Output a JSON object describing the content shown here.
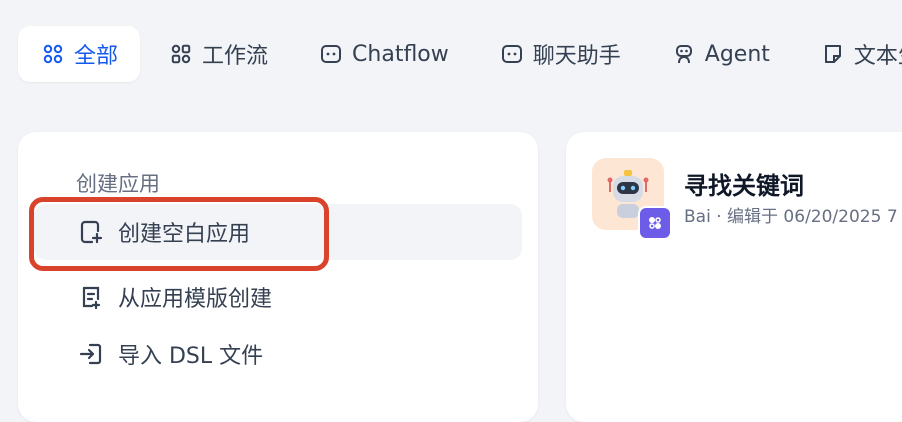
{
  "tabs": [
    {
      "label": "全部",
      "icon": "grid-icon",
      "active": true
    },
    {
      "label": "工作流",
      "icon": "workflow-icon",
      "active": false
    },
    {
      "label": "Chatflow",
      "icon": "chatflow-icon",
      "active": false
    },
    {
      "label": "聊天助手",
      "icon": "chat-assistant-icon",
      "active": false
    },
    {
      "label": "Agent",
      "icon": "agent-icon",
      "active": false
    },
    {
      "label": "文本生成",
      "icon": "text-generation-icon",
      "active": false
    }
  ],
  "create": {
    "section_label": "创建应用",
    "items": [
      {
        "label": "创建空白应用",
        "icon": "blank-app-icon"
      },
      {
        "label": "从应用模版创建",
        "icon": "template-icon"
      },
      {
        "label": "导入 DSL 文件",
        "icon": "import-icon"
      }
    ]
  },
  "app_card": {
    "title": "寻找关键词",
    "author": "Bai",
    "separator": "·",
    "edited_text": "编辑于 06/20/2025 7"
  },
  "colors": {
    "accent": "#155aef",
    "highlight": "#d9432b",
    "background": "#f2f4f7",
    "badge": "#6c5ce7"
  }
}
